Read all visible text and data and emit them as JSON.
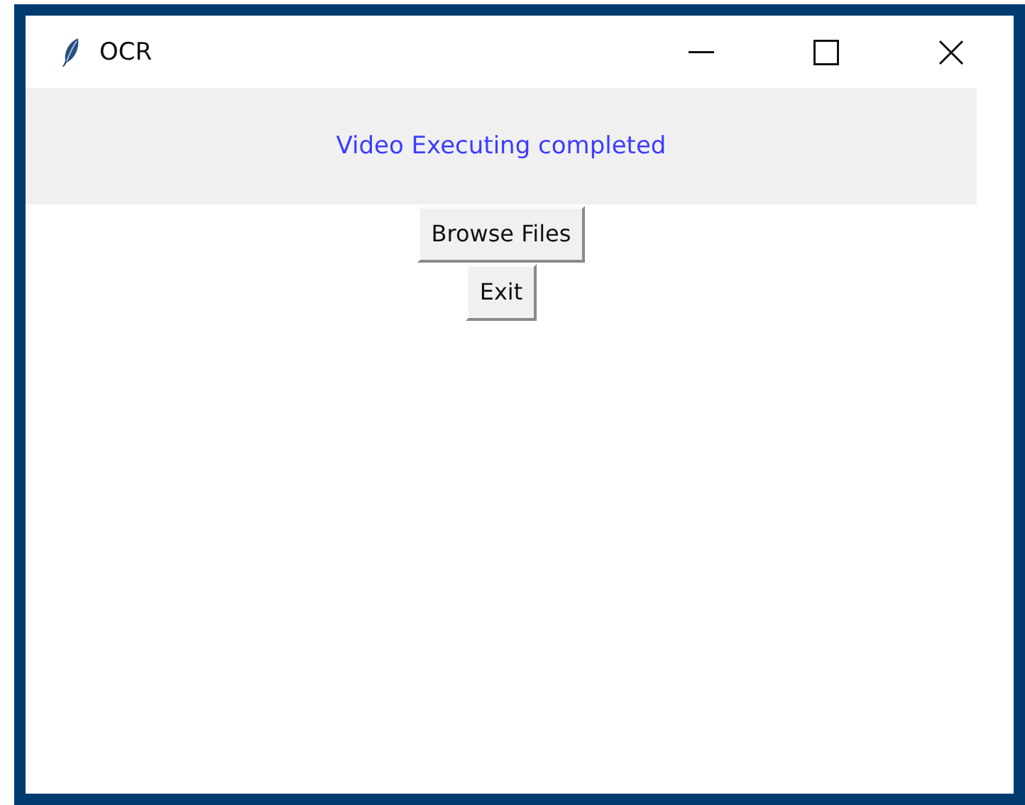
{
  "window": {
    "title": "OCR"
  },
  "status_label": "Video Executing completed",
  "buttons": [
    "Browse Files",
    "Exit"
  ]
}
